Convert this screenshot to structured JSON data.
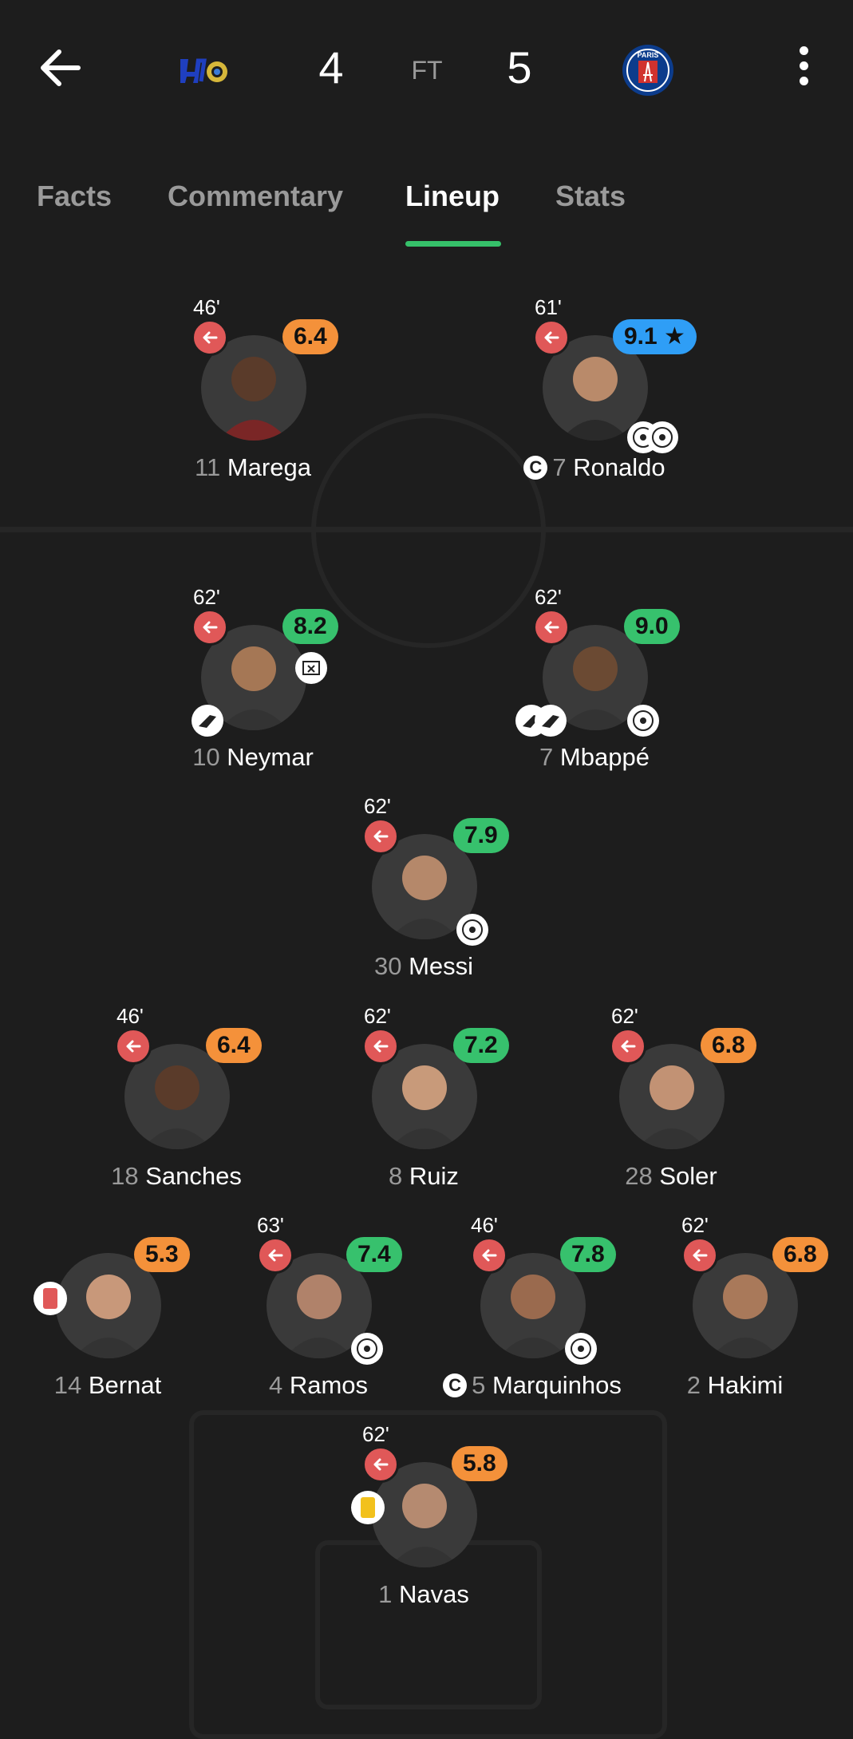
{
  "header": {
    "home_score": "4",
    "status": "FT",
    "away_score": "5",
    "away_logo_text": "PARIS"
  },
  "tabs": [
    "Facts",
    "Commentary",
    "Lineup",
    "Stats"
  ],
  "active_tab": "Lineup",
  "colors": {
    "accent_green": "#36c16a",
    "rating_green": "#37c16d",
    "rating_orange": "#f4913a",
    "rating_blue": "#2f9ef6",
    "sub_red": "#e05858"
  },
  "players": [
    {
      "number": "11",
      "name": "Marega",
      "minute": "46'",
      "rating": "6.4",
      "rating_color": "orange"
    },
    {
      "number": "7",
      "name": "Ronaldo",
      "minute": "61'",
      "rating": "9.1 ★",
      "rating_color": "blue",
      "captain": "C"
    },
    {
      "number": "10",
      "name": "Neymar",
      "minute": "62'",
      "rating": "8.2",
      "rating_color": "green"
    },
    {
      "number": "7",
      "name": "Mbappé",
      "minute": "62'",
      "rating": "9.0",
      "rating_color": "green"
    },
    {
      "number": "30",
      "name": "Messi",
      "minute": "62'",
      "rating": "7.9",
      "rating_color": "green"
    },
    {
      "number": "18",
      "name": "Sanches",
      "minute": "46'",
      "rating": "6.4",
      "rating_color": "orange"
    },
    {
      "number": "8",
      "name": "Ruiz",
      "minute": "62'",
      "rating": "7.2",
      "rating_color": "green"
    },
    {
      "number": "28",
      "name": "Soler",
      "minute": "62'",
      "rating": "6.8",
      "rating_color": "orange"
    },
    {
      "number": "14",
      "name": "Bernat",
      "minute": "",
      "rating": "5.3",
      "rating_color": "orange"
    },
    {
      "number": "4",
      "name": "Ramos",
      "minute": "63'",
      "rating": "7.4",
      "rating_color": "green"
    },
    {
      "number": "5",
      "name": "Marquinhos",
      "minute": "46'",
      "rating": "7.8",
      "rating_color": "green",
      "captain": "C"
    },
    {
      "number": "2",
      "name": "Hakimi",
      "minute": "62'",
      "rating": "6.8",
      "rating_color": "orange"
    },
    {
      "number": "1",
      "name": "Navas",
      "minute": "62'",
      "rating": "5.8",
      "rating_color": "orange"
    }
  ]
}
